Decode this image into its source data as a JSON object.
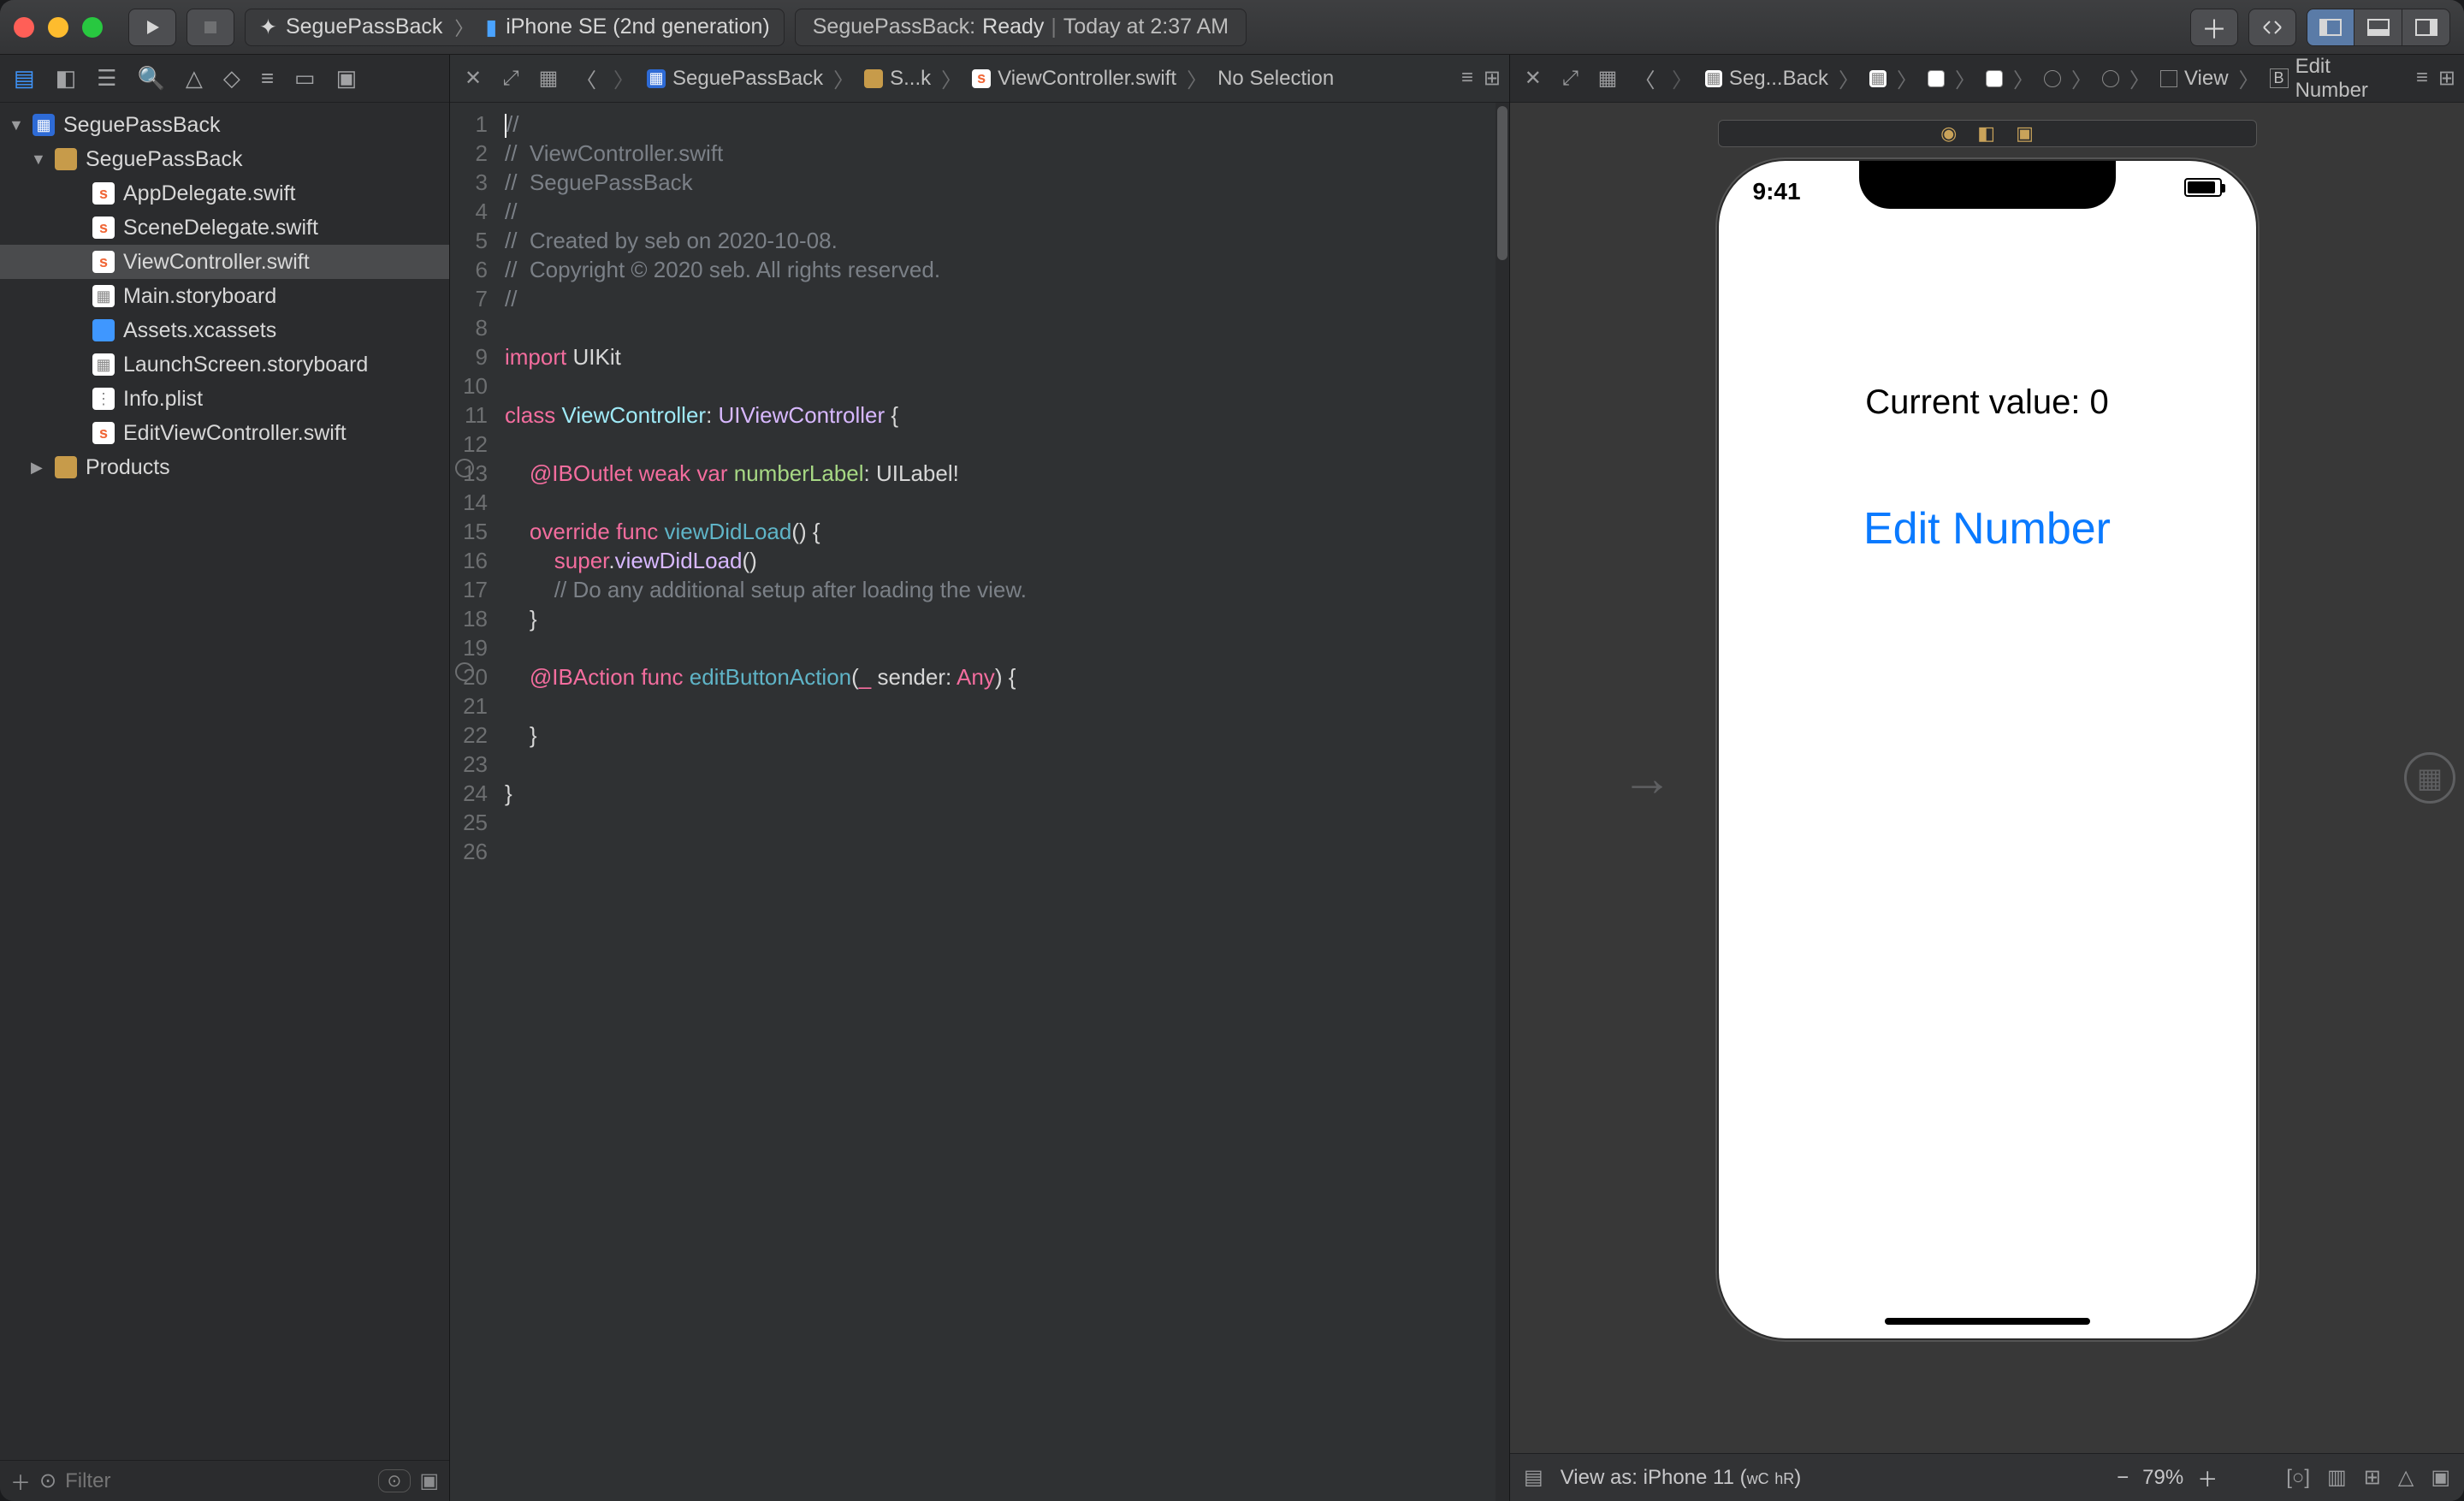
{
  "titlebar": {
    "scheme_left": "SeguePassBack",
    "scheme_right": "iPhone SE (2nd generation)",
    "status_project": "SeguePassBack:",
    "status_state": "Ready",
    "status_time": "Today at 2:37 AM"
  },
  "navigator": {
    "root": "SeguePassBack",
    "group": "SeguePassBack",
    "files": [
      {
        "name": "AppDelegate.swift",
        "kind": "swift"
      },
      {
        "name": "SceneDelegate.swift",
        "kind": "swift"
      },
      {
        "name": "ViewController.swift",
        "kind": "swift",
        "selected": true
      },
      {
        "name": "Main.storyboard",
        "kind": "sb"
      },
      {
        "name": "Assets.xcassets",
        "kind": "asset"
      },
      {
        "name": "LaunchScreen.storyboard",
        "kind": "sb"
      },
      {
        "name": "Info.plist",
        "kind": "plist"
      },
      {
        "name": "EditViewController.swift",
        "kind": "swift"
      }
    ],
    "products": "Products",
    "filter_placeholder": "Filter"
  },
  "editor": {
    "crumbs": [
      "SeguePassBack",
      "S...k",
      "ViewController.swift",
      "No Selection"
    ],
    "line_count": 26,
    "breakpoint_lines": [
      13,
      20
    ],
    "code": {
      "l1": "//",
      "l2": "//  ViewController.swift",
      "l3": "//  SeguePassBack",
      "l4": "//",
      "l5": "//  Created by seb on 2020-10-08.",
      "l6": "//  Copyright © 2020 seb. All rights reserved.",
      "l7": "//",
      "l9_kw": "import",
      "l9_typ": "UIKit",
      "l11_kw": "class",
      "l11_name": "ViewController",
      "l11_colon": ": ",
      "l11_uiv": "UIViewController",
      "l11_open": " {",
      "l13_a": "@IBOutlet",
      "l13_b": "weak",
      "l13_c": "var",
      "l13_d": "numberLabel",
      "l13_e": ": ",
      "l13_f": "UILabel",
      "l13_g": "!",
      "l15_a": "override",
      "l15_b": "func",
      "l15_c": "viewDidLoad",
      "l15_d": "() {",
      "l16_a": "super",
      "l16_b": ".",
      "l16_c": "viewDidLoad",
      "l16_d": "()",
      "l17": "// Do any additional setup after loading the view.",
      "l18": "}",
      "l20_a": "@IBAction",
      "l20_b": "func",
      "l20_c": "editButtonAction",
      "l20_d": "(",
      "l20_e": "_",
      "l20_f": " sender: ",
      "l20_g": "Any",
      "l20_h": ") {",
      "l22": "}",
      "l24": "}"
    }
  },
  "ib": {
    "crumbs": [
      "Seg...Back",
      "",
      "",
      "",
      "",
      "",
      "View",
      "Edit Number"
    ],
    "crumbs_text": {
      "0": "Seg...Back",
      "6": "View",
      "7": "Edit Number"
    },
    "crumb_prefix": "B",
    "phone_time": "9:41",
    "label_text": "Current value: 0",
    "button_text": "Edit Number",
    "bottom_device": "View as: iPhone 11 (",
    "bottom_wc": "wC",
    "bottom_hr": "hR",
    "bottom_close": ")",
    "zoom": "79%"
  }
}
